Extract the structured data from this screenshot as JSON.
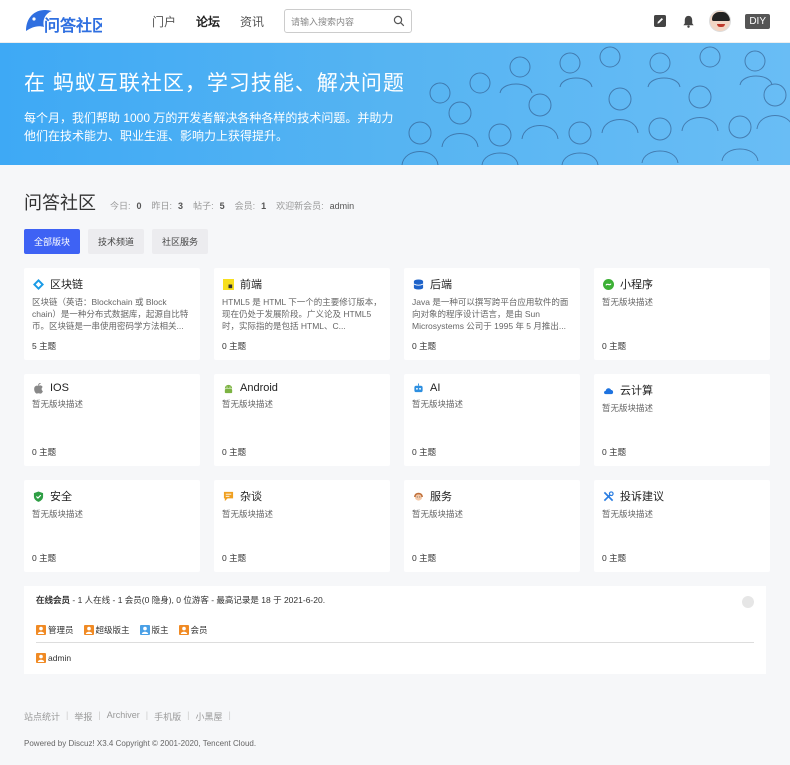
{
  "header": {
    "logo_text": "问答社区",
    "nav": [
      "门户",
      "论坛",
      "资讯"
    ],
    "search_placeholder": "请输入搜索内容",
    "diy_label": "DIY"
  },
  "banner": {
    "title": "在 蚂蚁互联社区，学习技能、解决问题",
    "subtitle": "每个月，我们帮助 1000 万的开发者解决各种各样的技术问题。并助力他们在技术能力、职业生涯、影响力上获得提升。"
  },
  "community": {
    "title": "问答社区",
    "stats": [
      {
        "label": "今日:",
        "value": "0"
      },
      {
        "label": "昨日:",
        "value": "3"
      },
      {
        "label": "帖子:",
        "value": "5"
      },
      {
        "label": "会员:",
        "value": "1"
      },
      {
        "label": "欢迎新会员:",
        "value": "admin"
      }
    ],
    "tabs": [
      "全部版块",
      "技术频道",
      "社区服务"
    ]
  },
  "forums": [
    {
      "name": "区块链",
      "icon": "blockchain-icon",
      "color": "#1a9be6",
      "desc": "区块链（英语：Blockchain 或 Block chain）是一种分布式数据库，起源自比特币。区块链是一串使用密码学方法相关...",
      "count": "5 主题"
    },
    {
      "name": "前端",
      "icon": "js-icon",
      "color": "#f7df1e",
      "desc": "HTML5 是 HTML 下一个的主要修订版本，现在仍处于发展阶段。广义论及 HTML5 时，实际指的是包括 HTML、C...",
      "count": "0 主题"
    },
    {
      "name": "后端",
      "icon": "database-icon",
      "color": "#1e63c9",
      "desc": "Java 是一种可以撰写跨平台应用软件的面向对象的程序设计语言，是由 Sun Microsystems 公司于 1995 年 5 月推出...",
      "count": "0 主题"
    },
    {
      "name": "小程序",
      "icon": "miniprogram-icon",
      "color": "#3cb035",
      "desc": "暂无版块描述",
      "count": "0 主题"
    },
    {
      "name": "IOS",
      "icon": "apple-icon",
      "color": "#888888",
      "desc": "暂无版块描述",
      "count": "0 主题"
    },
    {
      "name": "Android",
      "icon": "android-icon",
      "color": "#7cb342",
      "desc": "暂无版块描述",
      "count": "0 主题"
    },
    {
      "name": "AI",
      "icon": "robot-icon",
      "color": "#2d8fe0",
      "desc": "暂无版块描述",
      "count": "0 主题"
    },
    {
      "name": "云计算",
      "icon": "cloud-icon",
      "color": "#1e73e0",
      "desc": "暂无版块描述",
      "count": "0 主题"
    },
    {
      "name": "安全",
      "icon": "shield-icon",
      "color": "#2e9e44",
      "desc": "暂无版块描述",
      "count": "0 主题"
    },
    {
      "name": "杂谈",
      "icon": "chat-icon",
      "color": "#f0a020",
      "desc": "暂无版块描述",
      "count": "0 主题"
    },
    {
      "name": "服务",
      "icon": "service-icon",
      "color": "#c0703a",
      "desc": "暂无版块描述",
      "count": "0 主题"
    },
    {
      "name": "投诉建议",
      "icon": "tools-icon",
      "color": "#2a7de1",
      "desc": "暂无版块描述",
      "count": "0 主题"
    }
  ],
  "online": {
    "title": "在线会员",
    "summary": " - 1 人在线 - 1 会员(0 隐身), 0 位游客 - 最高记录是 18 于 2021-6-20.",
    "legend": [
      {
        "label": "管理员",
        "color": "#f08a24"
      },
      {
        "label": "超级版主",
        "color": "#f08a24"
      },
      {
        "label": "版主",
        "color": "#4aa0e6"
      },
      {
        "label": "会员",
        "color": "#f08a24"
      }
    ],
    "users": [
      "admin"
    ]
  },
  "footer": {
    "links": [
      "站点统计",
      "举报",
      "Archiver",
      "手机版",
      "小黑屋"
    ],
    "copyright": "Powered by Discuz! X3.4 Copyright © 2001-2020, Tencent Cloud."
  }
}
